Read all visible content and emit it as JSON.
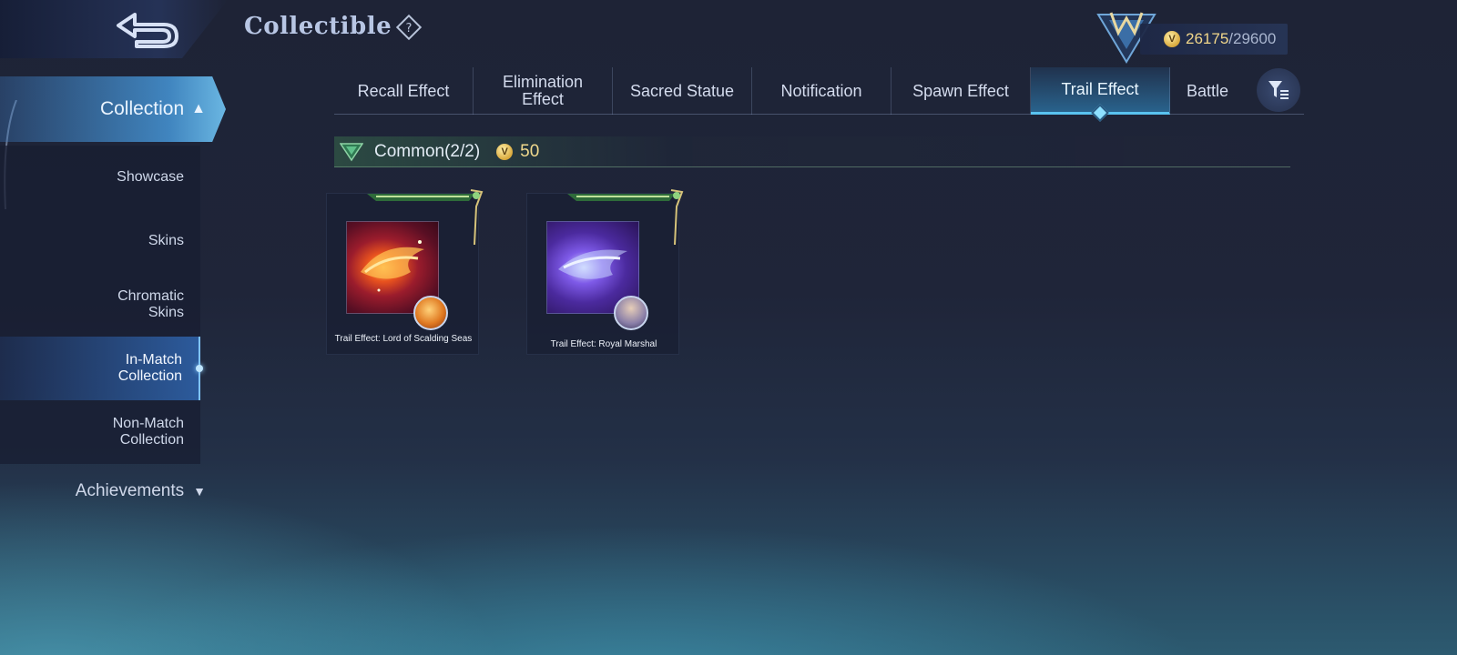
{
  "header": {
    "title": "Collectible",
    "currency_value": "26175",
    "currency_max": "/29600"
  },
  "sidebar": {
    "collection_label": "Collection",
    "items": [
      {
        "label": "Showcase"
      },
      {
        "label": "Skins"
      },
      {
        "label": "Chromatic Skins"
      },
      {
        "label": "In-Match Collection",
        "active": true
      },
      {
        "label": "Non-Match Collection"
      }
    ],
    "achievements_label": "Achievements"
  },
  "tabs": [
    {
      "label": "Recall Effect"
    },
    {
      "label": "Elimination Effect"
    },
    {
      "label": "Sacred Statue"
    },
    {
      "label": "Notification"
    },
    {
      "label": "Spawn Effect"
    },
    {
      "label": "Trail Effect",
      "active": true
    },
    {
      "label": "Battle"
    }
  ],
  "section": {
    "label": "Common(2/2)",
    "points": "50"
  },
  "cards": [
    {
      "label": "Trail Effect: Lord of Scalding Seas"
    },
    {
      "label": "Trail Effect: Royal Marshal"
    }
  ],
  "colors": {
    "accent": "#59c3f0",
    "gold": "#f0d98d",
    "sidebar_active": "#4a8fd0"
  }
}
